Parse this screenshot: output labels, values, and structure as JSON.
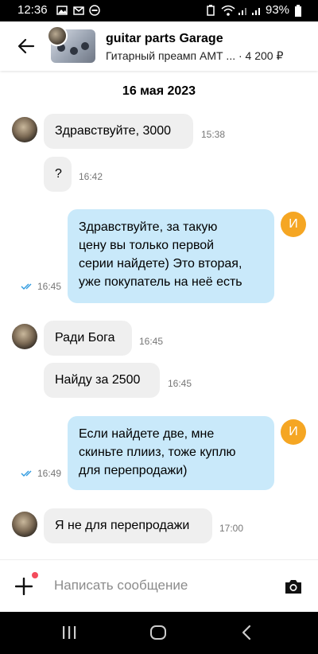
{
  "status_bar": {
    "time": "12:36",
    "battery": "93%"
  },
  "header": {
    "title": "guitar parts Garage",
    "subtitle": "Гитарный преамп АМТ ... · 4 200 ₽"
  },
  "date": "16 мая 2023",
  "messages": [
    {
      "text": "Здравствуйте, 3000",
      "time": "15:38"
    },
    {
      "text": "?",
      "time": "16:42"
    },
    {
      "lines": [
        "Здравствуйте, за такую",
        "цену вы только первой",
        "серии найдете) Это вторая,",
        "уже покупатель на неё есть"
      ],
      "time": "16:45",
      "avatar_letter": "И"
    },
    {
      "text": "Ради Бога",
      "time": "16:45"
    },
    {
      "text": "Найду за 2500",
      "time": "16:45"
    },
    {
      "lines": [
        "Если найдете две, мне",
        "скиньте плииз, тоже куплю",
        "для перепродажи)"
      ],
      "time": "16:49",
      "avatar_letter": "И"
    },
    {
      "text": "Я не для перепродажи",
      "time": "17:00"
    }
  ],
  "composer": {
    "placeholder": "Написать сообщение"
  },
  "colors": {
    "outgoing_bubble": "#c9e9fa",
    "incoming_bubble": "#efefef",
    "my_avatar": "#f5a623",
    "tick": "#2f9be0"
  }
}
